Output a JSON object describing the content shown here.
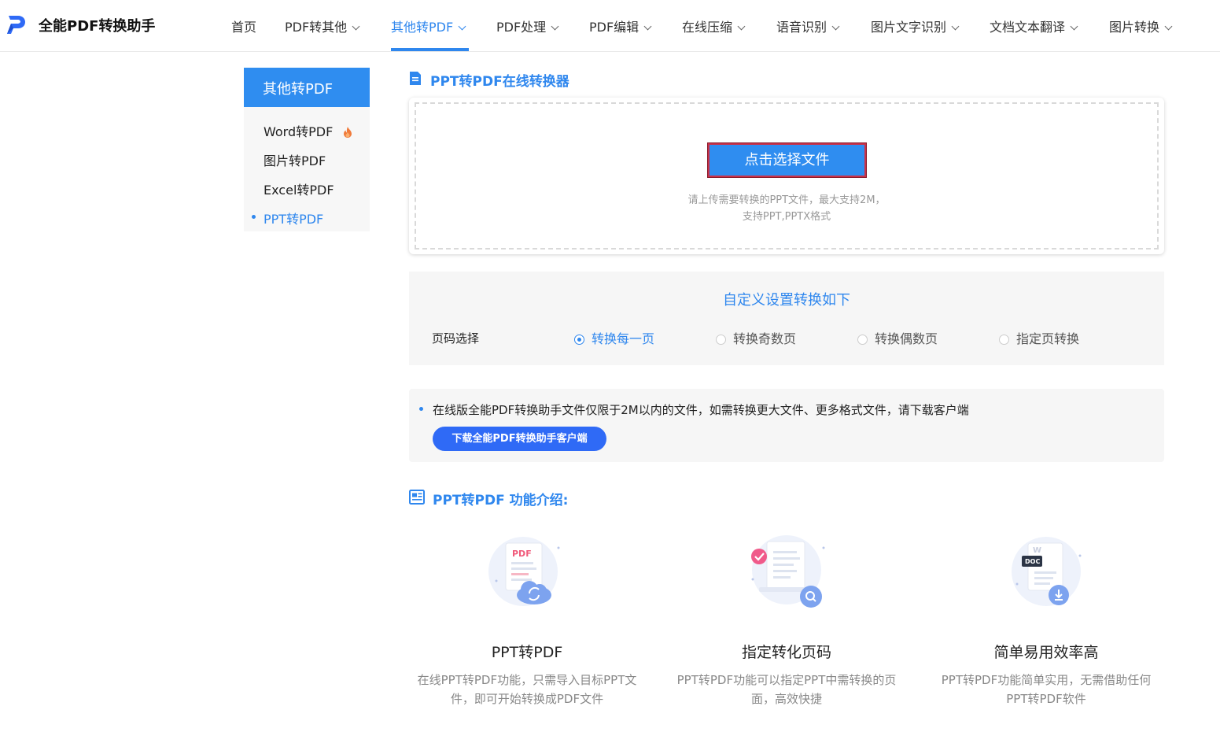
{
  "header": {
    "brand": "全能PDF转换助手",
    "nav": [
      {
        "label": "首页",
        "chevron": false
      },
      {
        "label": "PDF转其他",
        "chevron": true
      },
      {
        "label": "其他转PDF",
        "chevron": true,
        "active": true
      },
      {
        "label": "PDF处理",
        "chevron": true
      },
      {
        "label": "PDF编辑",
        "chevron": true
      },
      {
        "label": "在线压缩",
        "chevron": true
      },
      {
        "label": "语音识别",
        "chevron": true
      },
      {
        "label": "图片文字识别",
        "chevron": true
      },
      {
        "label": "文档文本翻译",
        "chevron": true
      },
      {
        "label": "图片转换",
        "chevron": true
      }
    ]
  },
  "sidebar": {
    "title": "其他转PDF",
    "items": [
      {
        "label": "Word转PDF",
        "hot": true
      },
      {
        "label": "图片转PDF"
      },
      {
        "label": "Excel转PDF"
      },
      {
        "label": "PPT转PDF",
        "active": true
      }
    ]
  },
  "converter": {
    "title": "PPT转PDF在线转换器",
    "choose_button": "点击选择文件",
    "hint_line1": "请上传需要转换的PPT文件，最大支持2M，",
    "hint_line2": "支持PPT,PPTX格式"
  },
  "settings": {
    "title": "自定义设置转换如下",
    "page_label": "页码选择",
    "options": [
      {
        "label": "转换每一页",
        "checked": true
      },
      {
        "label": "转换奇数页"
      },
      {
        "label": "转换偶数页"
      },
      {
        "label": "指定页转换"
      }
    ]
  },
  "notice": {
    "text": "在线版全能PDF转换助手文件仅限于2M以内的文件，如需转换更大文件、更多格式文件，请下载客户端",
    "download_button": "下载全能PDF转换助手客户端"
  },
  "features": {
    "title": "PPT转PDF 功能介绍:",
    "items": [
      {
        "title": "PPT转PDF",
        "desc1": "在线PPT转PDF功能，只需导入目标PPT文",
        "desc2": "件，即可开始转换成PDF文件",
        "icon": "pdf-cloud-illustration",
        "badge": "PDF"
      },
      {
        "title": "指定转化页码",
        "desc1": "PPT转PDF功能可以指定PPT中需转换的页",
        "desc2": "面，高效快捷",
        "icon": "document-search-illustration"
      },
      {
        "title": "简单易用效率高",
        "desc1": "PPT转PDF功能简单实用，无需借助任何",
        "desc2": "PPT转PDF软件",
        "icon": "doc-download-illustration",
        "badge": "DOC"
      }
    ]
  },
  "colors": {
    "accent": "#2f87ee",
    "button": "#2f8df0",
    "download": "#2f6af6"
  }
}
